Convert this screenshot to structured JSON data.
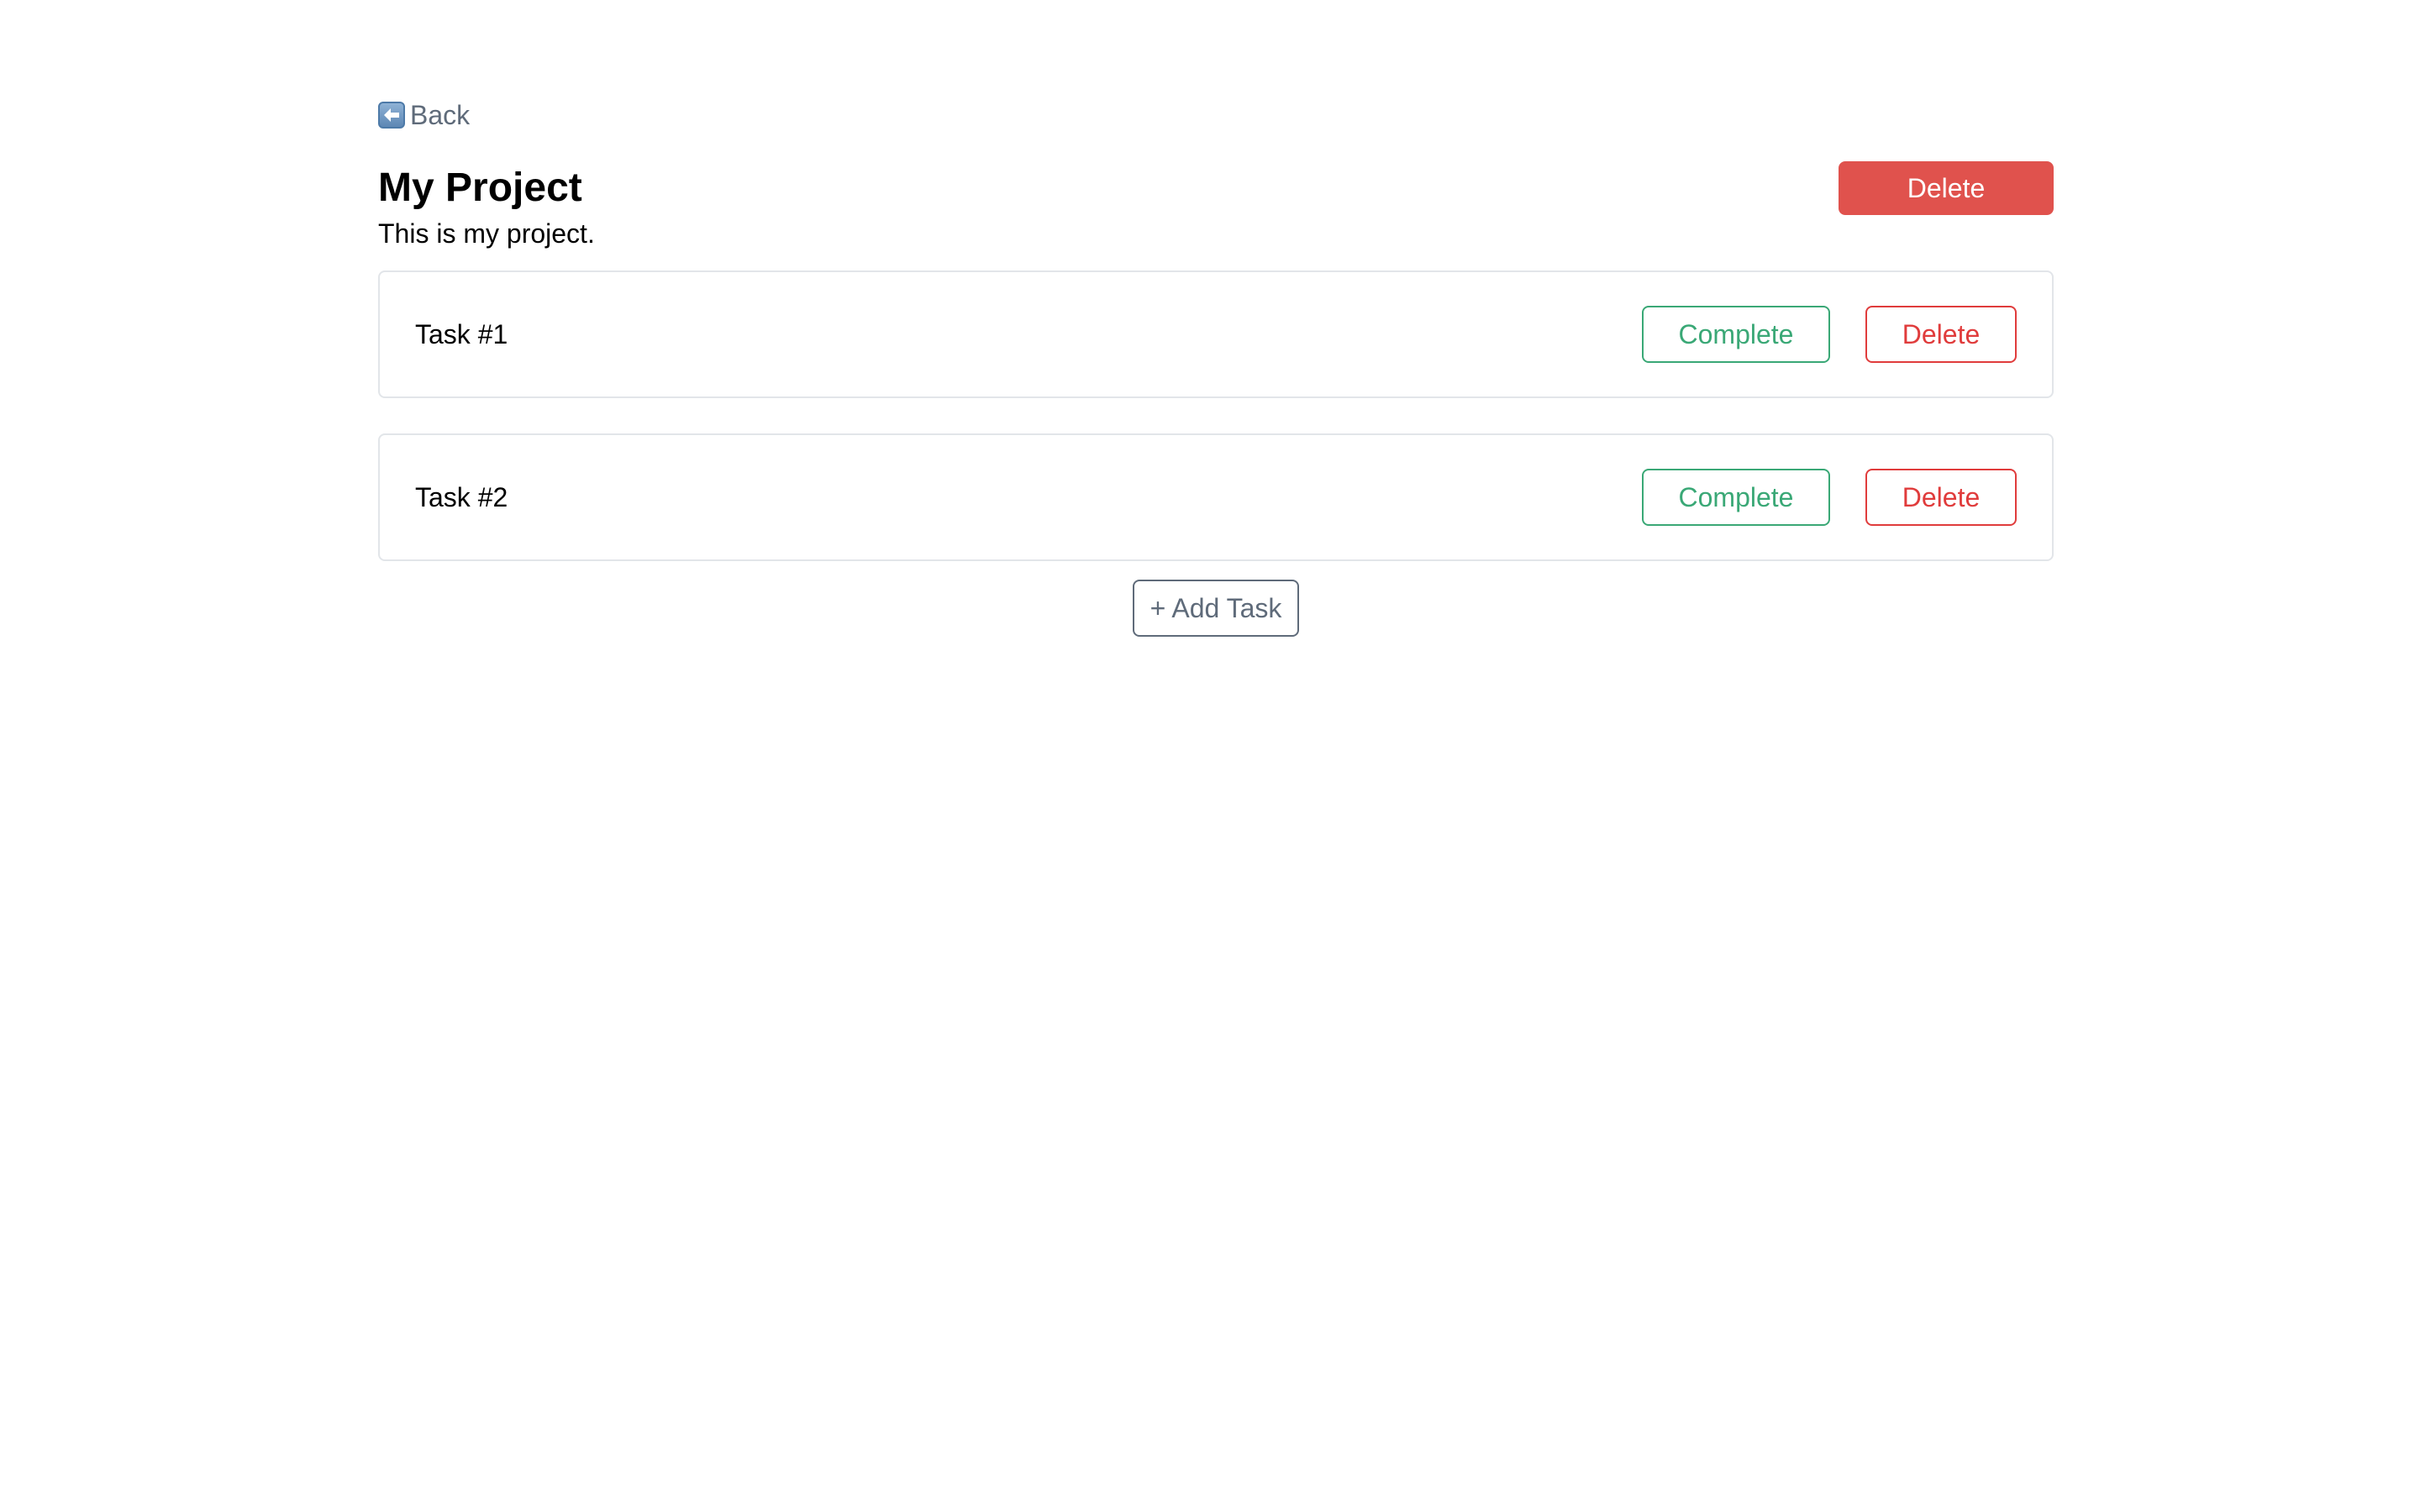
{
  "nav": {
    "back_label": "Back",
    "back_icon": "left-arrow-icon"
  },
  "project": {
    "title": "My Project",
    "description": "This is my project.",
    "delete_label": "Delete"
  },
  "tasks": [
    {
      "label": "Task #1",
      "complete_label": "Complete",
      "delete_label": "Delete"
    },
    {
      "label": "Task #2",
      "complete_label": "Complete",
      "delete_label": "Delete"
    }
  ],
  "actions": {
    "add_task_label": "+ Add Task"
  },
  "colors": {
    "danger_fill": "#e0524d",
    "danger_outline": "#e03c3c",
    "success_outline": "#3aa876",
    "muted": "#5f6b7a",
    "card_border": "#e2e5e9"
  }
}
